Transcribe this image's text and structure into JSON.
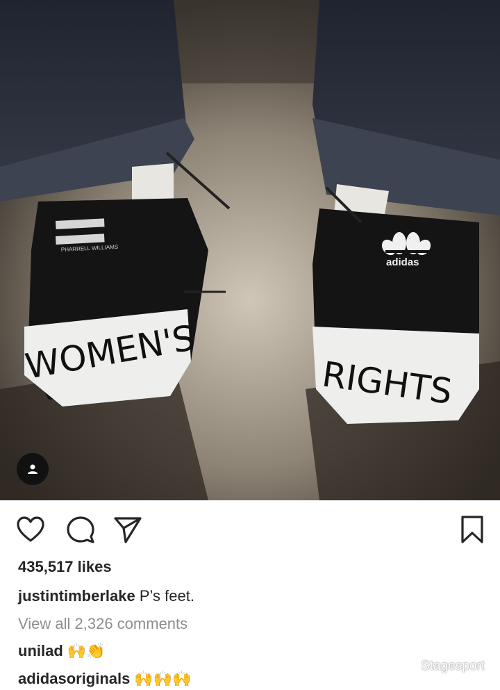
{
  "photo": {
    "left_shoe_text": "WOMEN'S",
    "right_shoe_text": "RIGHTS",
    "left_heel_label": "PHARRELL WILLIAMS",
    "right_heel_brand": "adidas",
    "tag_icon": "user-tag-icon"
  },
  "actions": {
    "like_icon": "heart-icon",
    "comment_icon": "comment-icon",
    "share_icon": "paper-plane-icon",
    "save_icon": "bookmark-icon"
  },
  "post": {
    "likes": "435,517 likes",
    "author": "justintimberlake",
    "caption": "P’s feet.",
    "view_comments": "View all 2,326 comments"
  },
  "comments": [
    {
      "user": "unilad",
      "text": "🙌👏"
    },
    {
      "user": "adidasoriginals",
      "text": "🙌🙌🙌"
    }
  ],
  "watermark": {
    "text": "Stagesport",
    "icon": "wechat-icon"
  },
  "colors": {
    "text": "#262626",
    "muted": "#8e8e8e"
  }
}
